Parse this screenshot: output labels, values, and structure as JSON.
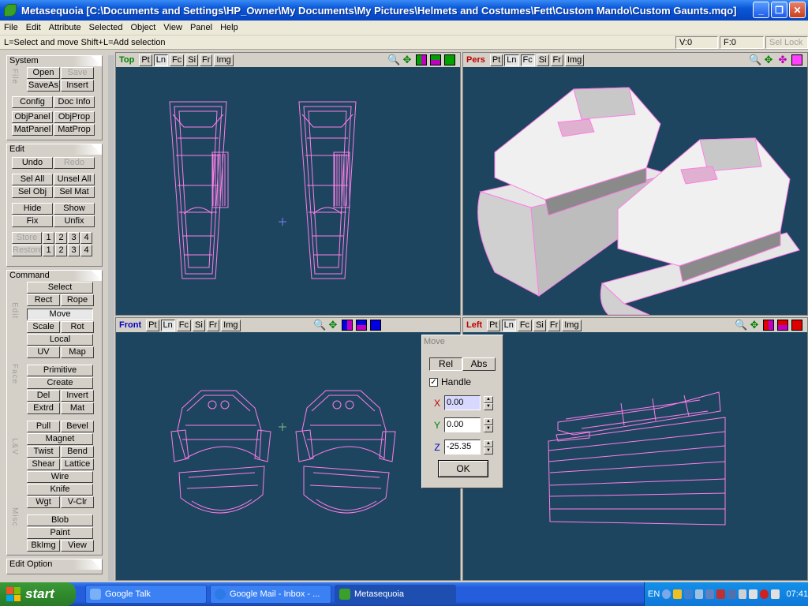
{
  "window": {
    "title": "Metasequoia [C:\\Documents and Settings\\HP_Owner\\My Documents\\My Pictures\\Helmets and Costumes\\Fett\\Custom Mando\\Custom Gaunts.mqo]",
    "minimize": "_",
    "restore": "❐",
    "close": "✕"
  },
  "menu": [
    "File",
    "Edit",
    "Attribute",
    "Selected",
    "Object",
    "View",
    "Panel",
    "Help"
  ],
  "status": {
    "text": "L=Select and move  Shift+L=Add selection",
    "v": "V:0",
    "f": "F:0",
    "sel_lock": "Sel Lock"
  },
  "panel": {
    "system": {
      "title": "System",
      "file_label": "File",
      "open": "Open",
      "save": "Save",
      "saveas": "SaveAs",
      "insert": "Insert",
      "config": "Config",
      "docinfo": "Doc Info",
      "objpanel": "ObjPanel",
      "objprop": "ObjProp",
      "matpanel": "MatPanel",
      "matprop": "MatProp"
    },
    "edit": {
      "title": "Edit",
      "undo": "Undo",
      "redo": "Redo",
      "selall": "Sel All",
      "unselall": "Unsel All",
      "selobj": "Sel Obj",
      "selmat": "Sel Mat",
      "hide": "Hide",
      "show": "Show",
      "fix": "Fix",
      "unfix": "Unfix",
      "store": "Store",
      "restore": "Restore",
      "nums": [
        "1",
        "2",
        "3",
        "4"
      ]
    },
    "command": {
      "title": "Command",
      "edit_label": "Edit",
      "face_label": "Face",
      "lv_label": "L&V",
      "misc_label": "Misc",
      "select": "Select",
      "rect": "Rect",
      "rope": "Rope",
      "move": "Move",
      "scale": "Scale",
      "rot": "Rot",
      "local": "Local",
      "uv": "UV",
      "map": "Map",
      "primitive": "Primitive",
      "create": "Create",
      "del": "Del",
      "invert": "Invert",
      "extrd": "Extrd",
      "mat": "Mat",
      "pull": "Pull",
      "bevel": "Bevel",
      "magnet": "Magnet",
      "twist": "Twist",
      "bend": "Bend",
      "shear": "Shear",
      "lattice": "Lattice",
      "wire": "Wire",
      "knife": "Knife",
      "wgt": "Wgt",
      "vclr": "V-Clr",
      "blob": "Blob",
      "paint": "Paint",
      "bkimg": "BkImg",
      "view": "View"
    },
    "editoption": {
      "title": "Edit Option"
    }
  },
  "viewport_buttons": [
    "Pt",
    "Ln",
    "Fc",
    "Si",
    "Fr",
    "Img"
  ],
  "viewports": {
    "top": {
      "name": "Top",
      "color": "#008000"
    },
    "pers": {
      "name": "Pers",
      "color": "#c00000"
    },
    "front": {
      "name": "Front",
      "color": "#0000c0"
    },
    "left": {
      "name": "Left",
      "color": "#c00000"
    }
  },
  "move_dialog": {
    "title": "Move",
    "rel": "Rel",
    "abs": "Abs",
    "handle": "Handle",
    "check": "✓",
    "x_label": "X",
    "x": "0.00",
    "y_label": "Y",
    "y": "0.00",
    "z_label": "Z",
    "z": "-25.35",
    "ok": "OK"
  },
  "taskbar": {
    "start": "start",
    "tasks": [
      "Google Talk",
      "Google Mail - Inbox - ...",
      "Metasequoia"
    ],
    "lang": "EN",
    "clock": "07:41"
  },
  "colors": {
    "wire": "#ff7de6",
    "viewport_bg": "#1d4560",
    "xp_blue": "#245edc"
  }
}
